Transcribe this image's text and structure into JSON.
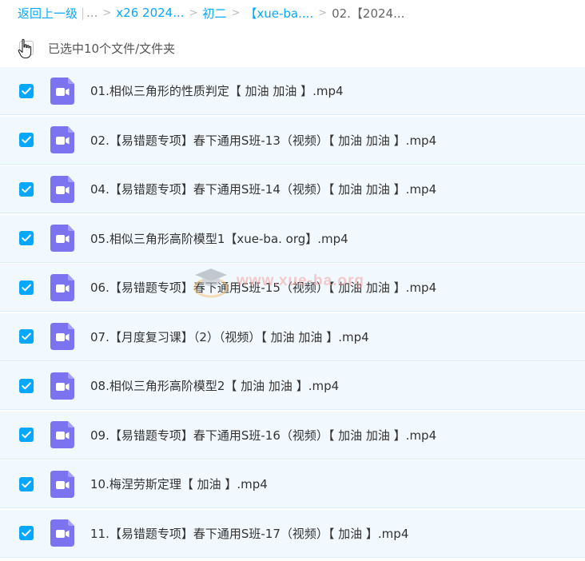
{
  "breadcrumb": {
    "back": "返回上一级",
    "ellipsis": "...",
    "items": [
      "x26 2024...",
      "初二",
      "【xue-ba....",
      "02.【2024..."
    ],
    "separator": ">"
  },
  "selection": {
    "text": "已选中10个文件/文件夹"
  },
  "files": [
    {
      "name": "01.相似三角形的性质判定【 加油 加油 】.mp4",
      "checked": true
    },
    {
      "name": "02.【易错题专项】春下通用S班-13（视频）【 加油 加油 】.mp4",
      "checked": true
    },
    {
      "name": "04.【易错题专项】春下通用S班-14（视频）【 加油 加油 】.mp4",
      "checked": true
    },
    {
      "name": "05.相似三角形高阶模型1【xue-ba. org】.mp4",
      "checked": true
    },
    {
      "name": "06.【易错题专项】春下通用S班-15（视频）【 加油 加油 】.mp4",
      "checked": true
    },
    {
      "name": "07.【月度复习课】（2）（视频）【 加油 加油 】.mp4",
      "checked": true
    },
    {
      "name": "08.相似三角形高阶模型2【 加油 加油 】.mp4",
      "checked": true
    },
    {
      "name": "09.【易错题专项】春下通用S班-16（视频）【 加油 加油 】.mp4",
      "checked": true
    },
    {
      "name": "10.梅涅劳斯定理【 加油 】.mp4",
      "checked": true
    },
    {
      "name": "11.【易错题专项】春下通用S班-17（视频）【 加油 】.mp4",
      "checked": true
    }
  ],
  "watermark": "www.xue-ba.org",
  "colors": {
    "accent": "#06a7ff",
    "row_bg": "#f1f8fe",
    "video_icon": "#7b73f0"
  },
  "icons": {
    "file": "video-file-icon",
    "check": "check-icon",
    "cursor": "hand-pointer-icon"
  }
}
